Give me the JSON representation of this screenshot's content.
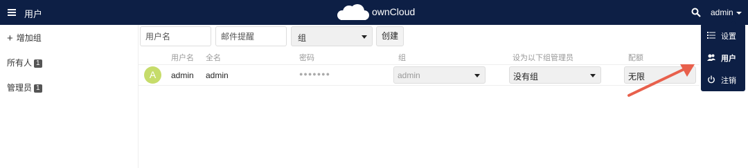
{
  "header": {
    "title": "用户",
    "brand": "ownCloud",
    "user": "admin"
  },
  "sidebar": {
    "add_group": "增加组",
    "groups": [
      {
        "name": "所有人",
        "count": "1"
      },
      {
        "name": "管理员",
        "count": "1"
      }
    ]
  },
  "toolbar": {
    "username_placeholder": "用户名",
    "email_placeholder": "邮件提醒",
    "group_select": "组",
    "create_button": "创建"
  },
  "table": {
    "columns": [
      "用户名",
      "全名",
      "密码",
      "组",
      "设为以下组管理员",
      "配额"
    ],
    "rows": [
      {
        "avatar_letter": "A",
        "username": "admin",
        "fullname": "admin",
        "password": "●●●●●●●",
        "group": "admin",
        "subadmin": "没有组",
        "quota": "无限"
      }
    ]
  },
  "dropdown": {
    "items": [
      {
        "label": "设置",
        "icon": "settings-list-icon"
      },
      {
        "label": "用户",
        "icon": "users-icon"
      },
      {
        "label": "注销",
        "icon": "power-icon"
      }
    ]
  },
  "colors": {
    "header_bg": "#0d1f45",
    "avatar_bg": "#c6dc6a",
    "arrow": "#e8604c"
  }
}
